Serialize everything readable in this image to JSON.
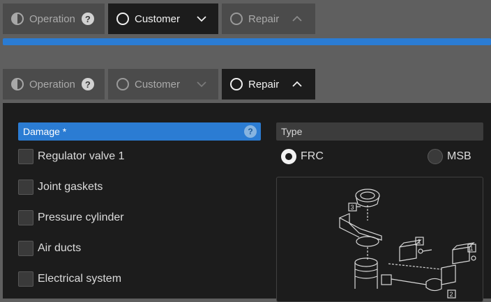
{
  "tabs_top": [
    {
      "label": "Operation",
      "icon": "half-circle-icon",
      "state": "done"
    },
    {
      "label": "Customer",
      "icon": "circle-icon",
      "state": "active",
      "chevron": "chevron-down-icon"
    },
    {
      "label": "Repair",
      "icon": "circle-icon",
      "state": "inactive",
      "chevron": "chevron-up-icon"
    }
  ],
  "tabs_bottom": [
    {
      "label": "Operation",
      "icon": "half-circle-icon",
      "state": "done"
    },
    {
      "label": "Customer",
      "icon": "circle-icon",
      "state": "inactive",
      "chevron": "chevron-down-icon"
    },
    {
      "label": "Repair",
      "icon": "circle-icon",
      "state": "active",
      "chevron": "chevron-up-icon"
    }
  ],
  "help_glyph": "?",
  "progress": {
    "fraction": 1.0,
    "color": "#2b7cd3"
  },
  "damage": {
    "label": "Damage *",
    "items": [
      {
        "label": "Regulator valve 1",
        "checked": false
      },
      {
        "label": "Joint gaskets",
        "checked": false
      },
      {
        "label": "Pressure cylinder",
        "checked": false
      },
      {
        "label": "Air ducts",
        "checked": false
      },
      {
        "label": "Electrical system",
        "checked": false
      }
    ]
  },
  "type": {
    "label": "Type",
    "options": [
      {
        "label": "FRC",
        "selected": true
      },
      {
        "label": "MSB",
        "selected": false
      }
    ]
  },
  "diagram_callouts": [
    "3",
    "1",
    "1",
    "2"
  ],
  "colors": {
    "accent": "#2b7cd3",
    "panel": "#1c1c1c",
    "background": "#5f5f5f",
    "tab_inactive": "#4b4b4b"
  }
}
